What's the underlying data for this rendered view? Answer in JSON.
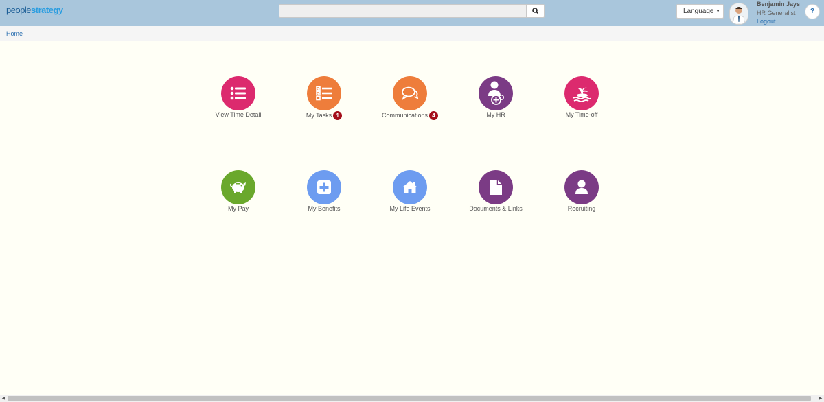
{
  "header": {
    "logo_part1": "people",
    "logo_part2": "strategy",
    "search_placeholder": "",
    "search_icon": "search-icon",
    "language_label": "Language",
    "user_name": "Benjamin Jays",
    "user_role": "HR Generalist",
    "logout_label": "Logout",
    "help_label": "?"
  },
  "breadcrumb": {
    "home": "Home"
  },
  "tiles_row1": [
    {
      "label": "View Time Detail",
      "icon": "list-icon",
      "color": "#dc2a6e",
      "badge": ""
    },
    {
      "label": "My Tasks",
      "icon": "checklist-icon",
      "color": "#ee7d3b",
      "badge": "1"
    },
    {
      "label": "Communications",
      "icon": "chat-bubbles-icon",
      "color": "#ee7d3b",
      "badge": "4"
    },
    {
      "label": "My HR",
      "icon": "user-add-icon",
      "color": "#7b3b85",
      "badge": ""
    },
    {
      "label": "My Time-off",
      "icon": "island-icon",
      "color": "#dc2a6e",
      "badge": ""
    }
  ],
  "tiles_row2": [
    {
      "label": "My Pay",
      "icon": "piggy-bank-icon",
      "color": "#6aa82c",
      "badge": ""
    },
    {
      "label": "My Benefits",
      "icon": "plus-square-icon",
      "color": "#6d9cf0",
      "badge": ""
    },
    {
      "label": "My Life Events",
      "icon": "home-icon",
      "color": "#6d9cf0",
      "badge": ""
    },
    {
      "label": "Documents & Links",
      "icon": "document-icon",
      "color": "#7b3b85",
      "badge": ""
    },
    {
      "label": "Recruiting",
      "icon": "user-icon",
      "color": "#7b3b85",
      "badge": ""
    }
  ]
}
